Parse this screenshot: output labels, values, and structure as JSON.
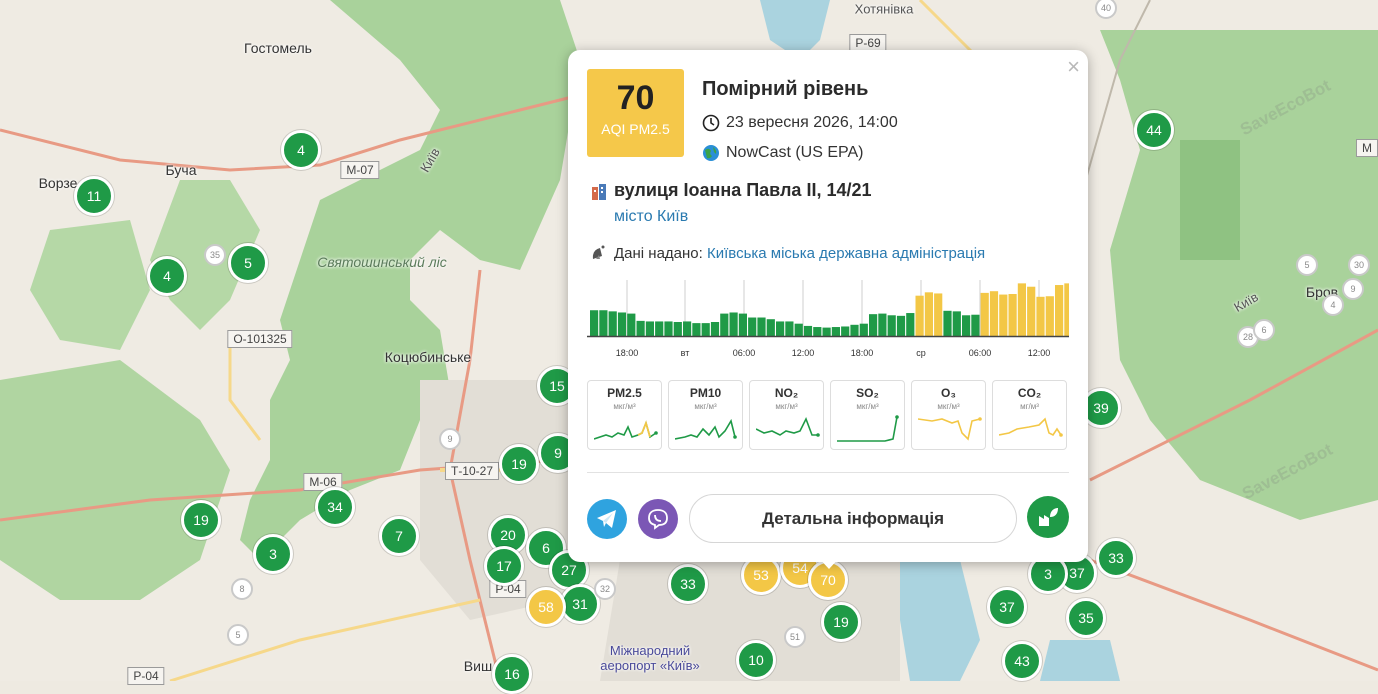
{
  "map": {
    "places": [
      {
        "name": "Гостомель",
        "cls": ""
      },
      {
        "name": "Буча",
        "cls": ""
      },
      {
        "name": "Ворзе",
        "cls": ""
      },
      {
        "name": "Святошинський ліс",
        "cls": "it"
      },
      {
        "name": "Коцюбинське",
        "cls": ""
      },
      {
        "name": "Хотянівка",
        "cls": "small"
      },
      {
        "name": "Міжнародний аеропорт «Київ»",
        "cls": "blue"
      },
      {
        "name": "Бров",
        "cls": ""
      },
      {
        "name": "Київ",
        "cls": "small"
      },
      {
        "name": "Київ",
        "cls": "small"
      },
      {
        "name": "Виш",
        "cls": ""
      }
    ],
    "roads": [
      "Р-69",
      "М-07",
      "О-101325",
      "Т-10-27",
      "М-06",
      "Р-04",
      "Р-04",
      "М"
    ],
    "watermark": "SaveEcoBot",
    "markers": [
      {
        "v": "4",
        "c": "g"
      },
      {
        "v": "11",
        "c": "g"
      },
      {
        "v": "4",
        "c": "g"
      },
      {
        "v": "5",
        "c": "g"
      },
      {
        "v": "35",
        "c": "s"
      },
      {
        "v": "15",
        "c": "g"
      },
      {
        "v": "9",
        "c": "g"
      },
      {
        "v": "19",
        "c": "g"
      },
      {
        "v": "9",
        "c": "s"
      },
      {
        "v": "19",
        "c": "g"
      },
      {
        "v": "34",
        "c": "g"
      },
      {
        "v": "7",
        "c": "g"
      },
      {
        "v": "3",
        "c": "g"
      },
      {
        "v": "20",
        "c": "g"
      },
      {
        "v": "6",
        "c": "g"
      },
      {
        "v": "17",
        "c": "g"
      },
      {
        "v": "27",
        "c": "g"
      },
      {
        "v": "31",
        "c": "g"
      },
      {
        "v": "58",
        "c": "y"
      },
      {
        "v": "32",
        "c": "s"
      },
      {
        "v": "8",
        "c": "s"
      },
      {
        "v": "5",
        "c": "s"
      },
      {
        "v": "33",
        "c": "g"
      },
      {
        "v": "53",
        "c": "y"
      },
      {
        "v": "54",
        "c": "y"
      },
      {
        "v": "70",
        "c": "y"
      },
      {
        "v": "19",
        "c": "g"
      },
      {
        "v": "51",
        "c": "s"
      },
      {
        "v": "10",
        "c": "g"
      },
      {
        "v": "16",
        "c": "g"
      },
      {
        "v": "44",
        "c": "g"
      },
      {
        "v": "39",
        "c": "g"
      },
      {
        "v": "33",
        "c": "g"
      },
      {
        "v": "37",
        "c": "g"
      },
      {
        "v": "3",
        "c": "g"
      },
      {
        "v": "37",
        "c": "g"
      },
      {
        "v": "35",
        "c": "g"
      },
      {
        "v": "43",
        "c": "g"
      },
      {
        "v": "40",
        "c": "s"
      },
      {
        "v": "5",
        "c": "s"
      },
      {
        "v": "30",
        "c": "s"
      },
      {
        "v": "9",
        "c": "s"
      },
      {
        "v": "4",
        "c": "s"
      },
      {
        "v": "28",
        "c": "s"
      },
      {
        "v": "6",
        "c": "s"
      }
    ]
  },
  "popup": {
    "aqi_value": "70",
    "aqi_label": "AQI PM2.5",
    "level": "Помірний рівень",
    "datetime": "23 вересня 2026, 14:00",
    "method": "NowCast (US EPA)",
    "address": "вулиця Іоанна Павла II, 14/21",
    "city": "місто Київ",
    "source_prefix": "Дані надано:",
    "source_name": "Київська міська державна адміністрація",
    "close_label": "×",
    "detail_button": "Детальна інформація",
    "chart": {
      "x_labels": [
        "18:00",
        "вт",
        "06:00",
        "12:00",
        "18:00",
        "ср",
        "06:00",
        "12:00"
      ],
      "values": [
        46,
        46,
        44,
        42,
        40,
        27,
        26,
        26,
        26,
        25,
        26,
        23,
        23,
        25,
        40,
        42,
        40,
        33,
        33,
        30,
        26,
        26,
        22,
        18,
        16,
        15,
        16,
        17,
        20,
        22,
        39,
        40,
        37,
        36,
        41,
        72,
        78,
        76,
        45,
        44,
        37,
        38,
        77,
        80,
        74,
        75,
        94,
        88,
        70,
        71,
        91,
        94
      ],
      "colors": {
        "good": "#1f9a47",
        "moderate": "#f3c746"
      },
      "moderate_threshold": 50
    },
    "pollutants": [
      {
        "name": "PM2.5",
        "unit": "мкг/м³",
        "color": "#1f9a47",
        "accent": "#f3c746"
      },
      {
        "name": "PM10",
        "unit": "мкг/м³",
        "color": "#1f9a47",
        "accent": ""
      },
      {
        "name": "NO₂",
        "unit": "мкг/м³",
        "color": "#1f9a47",
        "accent": ""
      },
      {
        "name": "SO₂",
        "unit": "мкг/м³",
        "color": "#1f9a47",
        "accent": ""
      },
      {
        "name": "O₃",
        "unit": "мкг/м³",
        "color": "#f3c746",
        "accent": ""
      },
      {
        "name": "CO₂",
        "unit": "мг/м³",
        "color": "#f3c746",
        "accent": ""
      }
    ]
  }
}
